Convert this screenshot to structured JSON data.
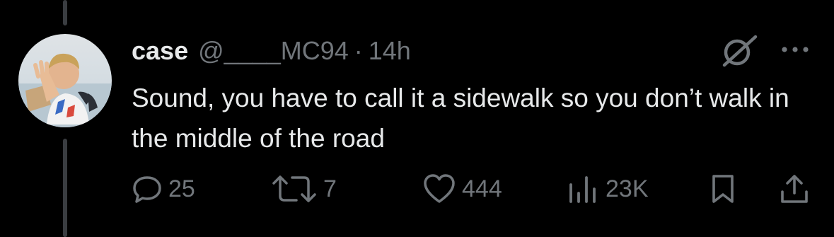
{
  "tweet": {
    "display_name": "case",
    "handle": "@____MC94",
    "separator": "·",
    "time": "14h",
    "text": "Sound, you have to call it a sidewalk so you don’t walk in the middle of the road"
  },
  "actions": {
    "replies": "25",
    "reposts": "7",
    "likes": "444",
    "views": "23K"
  },
  "icons": {
    "grok": "grok-icon",
    "more": "more-dots-icon",
    "reply": "reply-bubble-icon",
    "repost": "repost-arrows-icon",
    "like": "heart-icon",
    "views": "views-bars-icon",
    "bookmark": "bookmark-icon",
    "share": "share-icon"
  },
  "colors": {
    "background": "#000000",
    "primary_text": "#e7e9ea",
    "secondary_text": "#71767b",
    "thread_line": "#3a3d41"
  }
}
